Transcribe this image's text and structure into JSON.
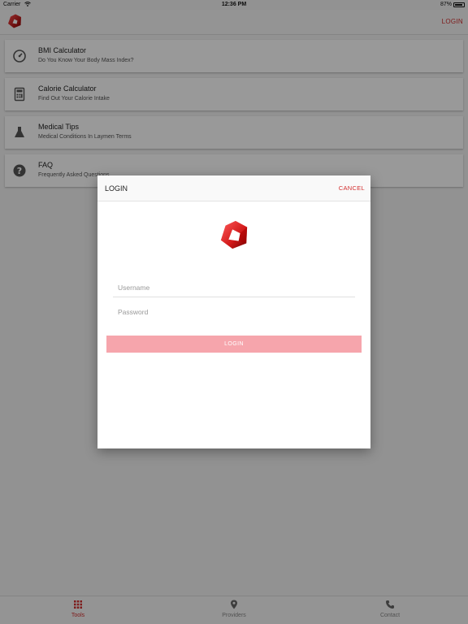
{
  "status_bar": {
    "carrier": "Carrier",
    "time": "12:36 PM",
    "battery": "87%"
  },
  "header": {
    "login_label": "LOGIN"
  },
  "menu": [
    {
      "title": "BMI Calculator",
      "subtitle": "Do You Know Your Body Mass Index?",
      "icon": "gauge-icon"
    },
    {
      "title": "Calorie Calculator",
      "subtitle": "Find Out Your Calorie Intake",
      "icon": "calculator-icon"
    },
    {
      "title": "Medical Tips",
      "subtitle": "Medical Conditions In Laymen Terms",
      "icon": "flask-icon"
    },
    {
      "title": "FAQ",
      "subtitle": "Frequently Asked Questions",
      "icon": "help-icon"
    }
  ],
  "modal": {
    "title": "LOGIN",
    "cancel_label": "CANCEL",
    "username_placeholder": "Username",
    "password_placeholder": "Password",
    "login_button": "LOGIN"
  },
  "tabs": [
    {
      "label": "Tools",
      "icon": "grid-icon",
      "active": true
    },
    {
      "label": "Providers",
      "icon": "map-pin-icon",
      "active": false
    },
    {
      "label": "Contact",
      "icon": "phone-icon",
      "active": false
    }
  ],
  "colors": {
    "accent": "#d32f2f",
    "login_button_disabled": "#f6a5ac"
  }
}
